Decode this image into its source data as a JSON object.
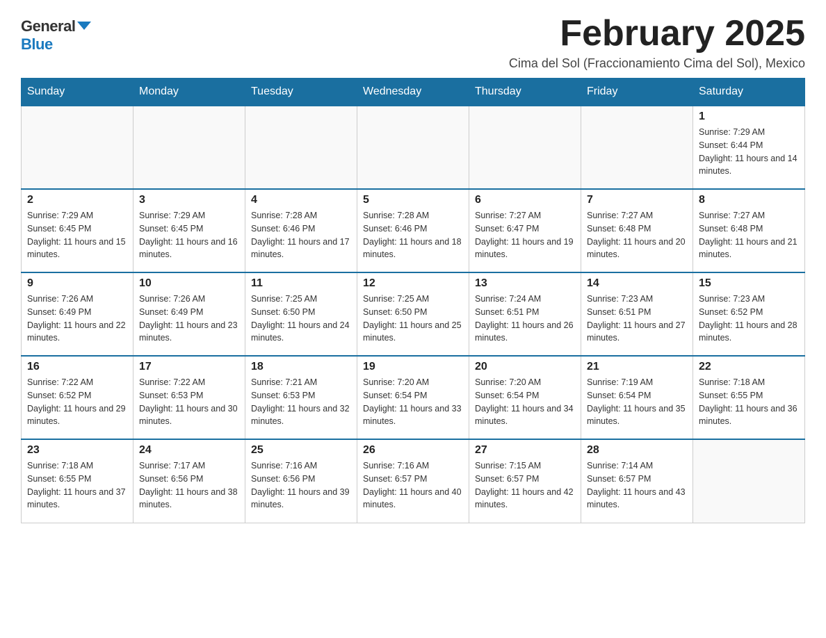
{
  "logo": {
    "general": "General",
    "blue": "Blue",
    "triangle": true
  },
  "title": {
    "month_year": "February 2025",
    "location": "Cima del Sol (Fraccionamiento Cima del Sol), Mexico"
  },
  "days_of_week": [
    "Sunday",
    "Monday",
    "Tuesday",
    "Wednesday",
    "Thursday",
    "Friday",
    "Saturday"
  ],
  "weeks": [
    [
      {
        "day": "",
        "info": ""
      },
      {
        "day": "",
        "info": ""
      },
      {
        "day": "",
        "info": ""
      },
      {
        "day": "",
        "info": ""
      },
      {
        "day": "",
        "info": ""
      },
      {
        "day": "",
        "info": ""
      },
      {
        "day": "1",
        "info": "Sunrise: 7:29 AM\nSunset: 6:44 PM\nDaylight: 11 hours and 14 minutes."
      }
    ],
    [
      {
        "day": "2",
        "info": "Sunrise: 7:29 AM\nSunset: 6:45 PM\nDaylight: 11 hours and 15 minutes."
      },
      {
        "day": "3",
        "info": "Sunrise: 7:29 AM\nSunset: 6:45 PM\nDaylight: 11 hours and 16 minutes."
      },
      {
        "day": "4",
        "info": "Sunrise: 7:28 AM\nSunset: 6:46 PM\nDaylight: 11 hours and 17 minutes."
      },
      {
        "day": "5",
        "info": "Sunrise: 7:28 AM\nSunset: 6:46 PM\nDaylight: 11 hours and 18 minutes."
      },
      {
        "day": "6",
        "info": "Sunrise: 7:27 AM\nSunset: 6:47 PM\nDaylight: 11 hours and 19 minutes."
      },
      {
        "day": "7",
        "info": "Sunrise: 7:27 AM\nSunset: 6:48 PM\nDaylight: 11 hours and 20 minutes."
      },
      {
        "day": "8",
        "info": "Sunrise: 7:27 AM\nSunset: 6:48 PM\nDaylight: 11 hours and 21 minutes."
      }
    ],
    [
      {
        "day": "9",
        "info": "Sunrise: 7:26 AM\nSunset: 6:49 PM\nDaylight: 11 hours and 22 minutes."
      },
      {
        "day": "10",
        "info": "Sunrise: 7:26 AM\nSunset: 6:49 PM\nDaylight: 11 hours and 23 minutes."
      },
      {
        "day": "11",
        "info": "Sunrise: 7:25 AM\nSunset: 6:50 PM\nDaylight: 11 hours and 24 minutes."
      },
      {
        "day": "12",
        "info": "Sunrise: 7:25 AM\nSunset: 6:50 PM\nDaylight: 11 hours and 25 minutes."
      },
      {
        "day": "13",
        "info": "Sunrise: 7:24 AM\nSunset: 6:51 PM\nDaylight: 11 hours and 26 minutes."
      },
      {
        "day": "14",
        "info": "Sunrise: 7:23 AM\nSunset: 6:51 PM\nDaylight: 11 hours and 27 minutes."
      },
      {
        "day": "15",
        "info": "Sunrise: 7:23 AM\nSunset: 6:52 PM\nDaylight: 11 hours and 28 minutes."
      }
    ],
    [
      {
        "day": "16",
        "info": "Sunrise: 7:22 AM\nSunset: 6:52 PM\nDaylight: 11 hours and 29 minutes."
      },
      {
        "day": "17",
        "info": "Sunrise: 7:22 AM\nSunset: 6:53 PM\nDaylight: 11 hours and 30 minutes."
      },
      {
        "day": "18",
        "info": "Sunrise: 7:21 AM\nSunset: 6:53 PM\nDaylight: 11 hours and 32 minutes."
      },
      {
        "day": "19",
        "info": "Sunrise: 7:20 AM\nSunset: 6:54 PM\nDaylight: 11 hours and 33 minutes."
      },
      {
        "day": "20",
        "info": "Sunrise: 7:20 AM\nSunset: 6:54 PM\nDaylight: 11 hours and 34 minutes."
      },
      {
        "day": "21",
        "info": "Sunrise: 7:19 AM\nSunset: 6:54 PM\nDaylight: 11 hours and 35 minutes."
      },
      {
        "day": "22",
        "info": "Sunrise: 7:18 AM\nSunset: 6:55 PM\nDaylight: 11 hours and 36 minutes."
      }
    ],
    [
      {
        "day": "23",
        "info": "Sunrise: 7:18 AM\nSunset: 6:55 PM\nDaylight: 11 hours and 37 minutes."
      },
      {
        "day": "24",
        "info": "Sunrise: 7:17 AM\nSunset: 6:56 PM\nDaylight: 11 hours and 38 minutes."
      },
      {
        "day": "25",
        "info": "Sunrise: 7:16 AM\nSunset: 6:56 PM\nDaylight: 11 hours and 39 minutes."
      },
      {
        "day": "26",
        "info": "Sunrise: 7:16 AM\nSunset: 6:57 PM\nDaylight: 11 hours and 40 minutes."
      },
      {
        "day": "27",
        "info": "Sunrise: 7:15 AM\nSunset: 6:57 PM\nDaylight: 11 hours and 42 minutes."
      },
      {
        "day": "28",
        "info": "Sunrise: 7:14 AM\nSunset: 6:57 PM\nDaylight: 11 hours and 43 minutes."
      },
      {
        "day": "",
        "info": ""
      }
    ]
  ]
}
